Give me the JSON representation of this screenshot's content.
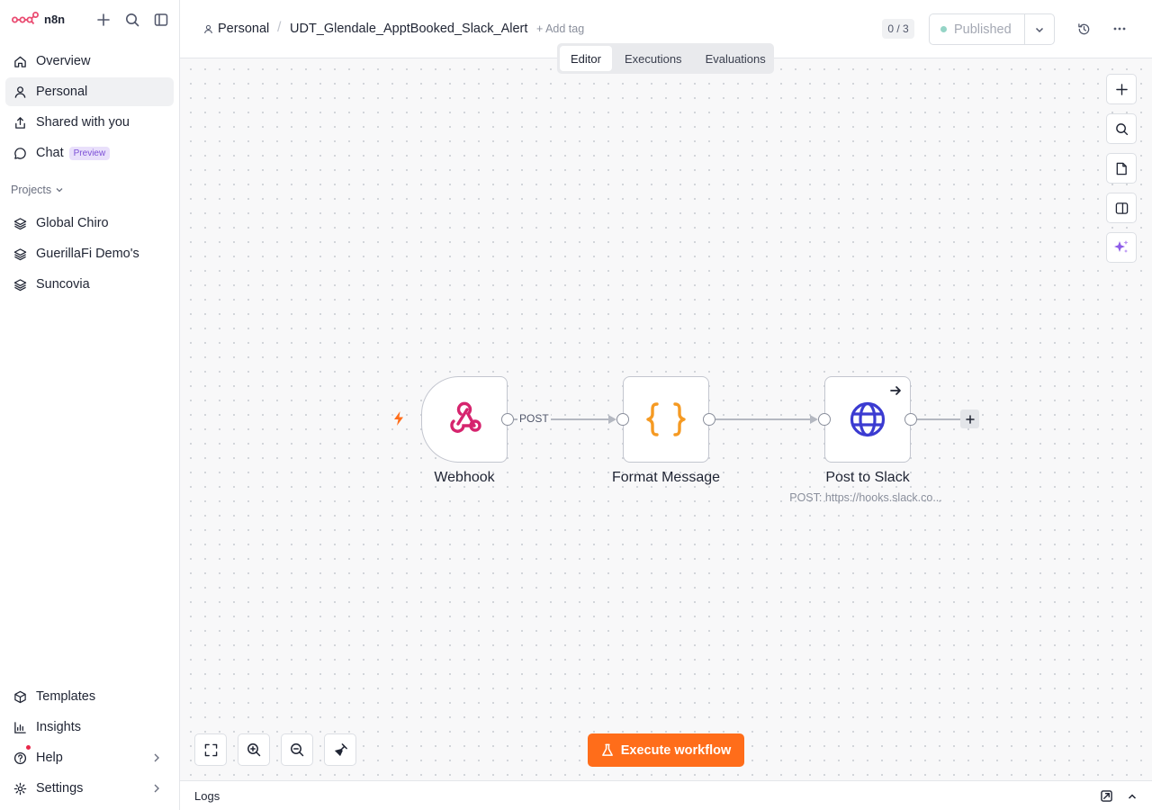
{
  "app": {
    "name": "n8n"
  },
  "sidebar": {
    "nav": [
      {
        "label": "Overview",
        "icon": "home-icon"
      },
      {
        "label": "Personal",
        "icon": "user-icon",
        "active": true
      },
      {
        "label": "Shared with you",
        "icon": "share-icon"
      },
      {
        "label": "Chat",
        "icon": "chat-icon",
        "badge": "Preview"
      }
    ],
    "projects_label": "Projects",
    "projects": [
      {
        "label": "Global Chiro",
        "icon": "layers-icon"
      },
      {
        "label": "GuerillaFi Demo's",
        "icon": "layers-icon"
      },
      {
        "label": "Suncovia",
        "icon": "layers-icon"
      }
    ],
    "bottom": [
      {
        "label": "Templates",
        "icon": "templates-icon"
      },
      {
        "label": "Insights",
        "icon": "insights-icon"
      },
      {
        "label": "Help",
        "icon": "help-icon"
      },
      {
        "label": "Settings",
        "icon": "gear-icon"
      }
    ]
  },
  "header": {
    "breadcrumb_project": "Personal",
    "workflow_name": "UDT_Glendale_ApptBooked_Slack_Alert",
    "add_tag": "+ Add tag",
    "counter": "0 / 3",
    "publish_label": "Published",
    "tabs": [
      "Editor",
      "Executions",
      "Evaluations"
    ],
    "active_tab": "Editor"
  },
  "canvas": {
    "nodes": [
      {
        "name": "Webhook",
        "icon": "webhook-icon",
        "trigger": true
      },
      {
        "name": "Format Message",
        "icon": "braces-icon"
      },
      {
        "name": "Post to Slack",
        "icon": "globe-icon",
        "subtitle": "POST: https://hooks.slack.co..."
      }
    ],
    "edge_label": "POST",
    "execute_label": "Execute workflow"
  },
  "logs": {
    "label": "Logs"
  },
  "colors": {
    "brand": "#ea4b71",
    "accent_orange": "#ff6d1a",
    "webhook_pink": "#d6246e",
    "braces_orange": "#f59a23",
    "globe_blue": "#3b3bd1",
    "published_dot": "#95d4c6"
  }
}
